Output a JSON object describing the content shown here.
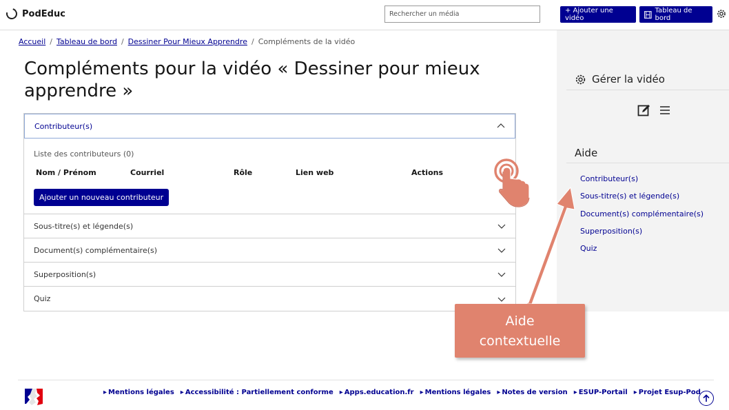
{
  "header": {
    "logo_text": "PodEduc",
    "search_placeholder": "Rechercher un média",
    "add_video_label": "+ Ajouter une vidéo",
    "dashboard_label": "Tableau de bord"
  },
  "breadcrumb": {
    "items": [
      "Accueil",
      "Tableau de bord",
      "Dessiner Pour Mieux Apprendre"
    ],
    "current": "Compléments de la vidéo"
  },
  "page_title": "Compléments pour la vidéo « Dessiner pour mieux apprendre »",
  "accordion": {
    "contributors": {
      "title": "Contributeur(s)",
      "list_title": "Liste des contributeurs (0)",
      "columns": [
        "Nom / Prénom",
        "Courriel",
        "Rôle",
        "Lien web",
        "Actions"
      ],
      "add_button": "Ajouter un nouveau contributeur"
    },
    "sections": [
      "Sous-titre(s) et légende(s)",
      "Document(s) complémentaire(s)",
      "Superposition(s)",
      "Quiz"
    ]
  },
  "sidebar": {
    "manage_title": "Gérer la vidéo",
    "help_title": "Aide",
    "help_links": [
      "Contributeur(s)",
      "Sous-titre(s) et légende(s)",
      "Document(s) complémentaire(s)",
      "Superposition(s)",
      "Quiz"
    ]
  },
  "callout": {
    "line1": "Aide",
    "line2": "contextuelle",
    "color": "#e0836e"
  },
  "footer": {
    "links": [
      "Mentions légales",
      "Accessibilité : Partiellement conforme",
      "Apps.education.fr",
      "Mentions légales",
      "Notes de version",
      "ESUP-Portail",
      "Projet Esup-Pod"
    ]
  },
  "colors": {
    "primary": "#000091",
    "sidebar_bg": "#f3f3f3"
  }
}
